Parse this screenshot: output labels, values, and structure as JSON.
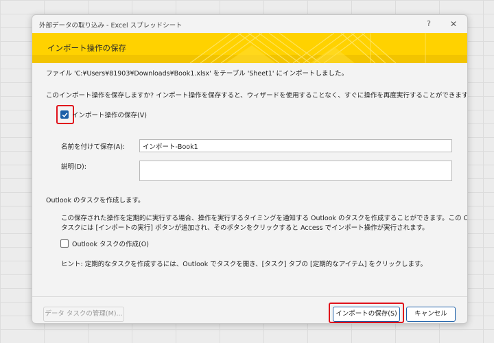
{
  "window": {
    "title": "外部データの取り込み - Excel スプレッドシート",
    "help_symbol": "?",
    "close_symbol": "✕"
  },
  "banner": {
    "title": "インポート操作の保存"
  },
  "body": {
    "import_status": "ファイル 'C:¥Users¥81903¥Downloads¥Book1.xlsx' をテーブル 'Sheet1' にインポートしました。",
    "save_question": "このインポート操作を保存しますか? インポート操作を保存すると、ウィザードを使用することなく、すぐに操作を再度実行することができます。",
    "save_checkbox": {
      "label": "インポート操作の保存(V)",
      "checked": true
    },
    "save_as": {
      "label": "名前を付けて保存(A):",
      "value": "インポート-Book1"
    },
    "description": {
      "label": "説明(D):",
      "value": ""
    },
    "outlook_heading": "Outlook のタスクを作成します。",
    "outlook_info_line1": "この保存された操作を定期的に実行する場合、操作を実行するタイミングを通知する Outlook のタスクを作成することができます。この Outlook の",
    "outlook_info_line2": "タスクには [インポートの実行] ボタンが追加され、そのボタンをクリックすると Access でインポート操作が実行されます。",
    "outlook_checkbox": {
      "label": "Outlook タスクの作成(O)",
      "checked": false
    },
    "hint": "ヒント: 定期的なタスクを作成するには、Outlook でタスクを開き、[タスク] タブの [定期的なアイテム] をクリックします。"
  },
  "footer": {
    "manage_tasks_label": "データ タスクの管理(M)...",
    "save_import_label": "インポートの保存(S)",
    "cancel_label": "キャンセル"
  },
  "colors": {
    "banner_yellow": "#ffd200",
    "accent_blue": "#1c5fa8",
    "highlight_red": "#e0111b"
  }
}
